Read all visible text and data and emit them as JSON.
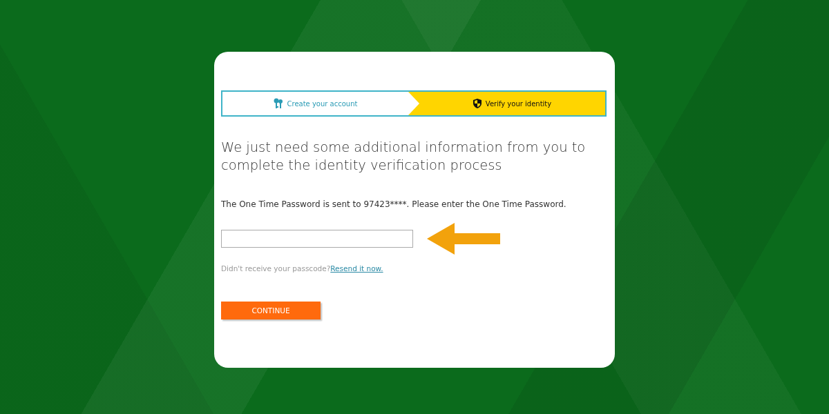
{
  "steps": [
    {
      "label": "Create your account",
      "selected": false
    },
    {
      "label": "Verify your identity",
      "selected": true
    }
  ],
  "heading": "We just need some additional information from you to complete the identity verification process",
  "otp_message": "The One Time Password is sent to 97423****. Please enter the One Time Password.",
  "resend": {
    "prompt": "Didn't receive your passcode?",
    "link": "Resend it now."
  },
  "continue_button": "CONTINUE"
}
